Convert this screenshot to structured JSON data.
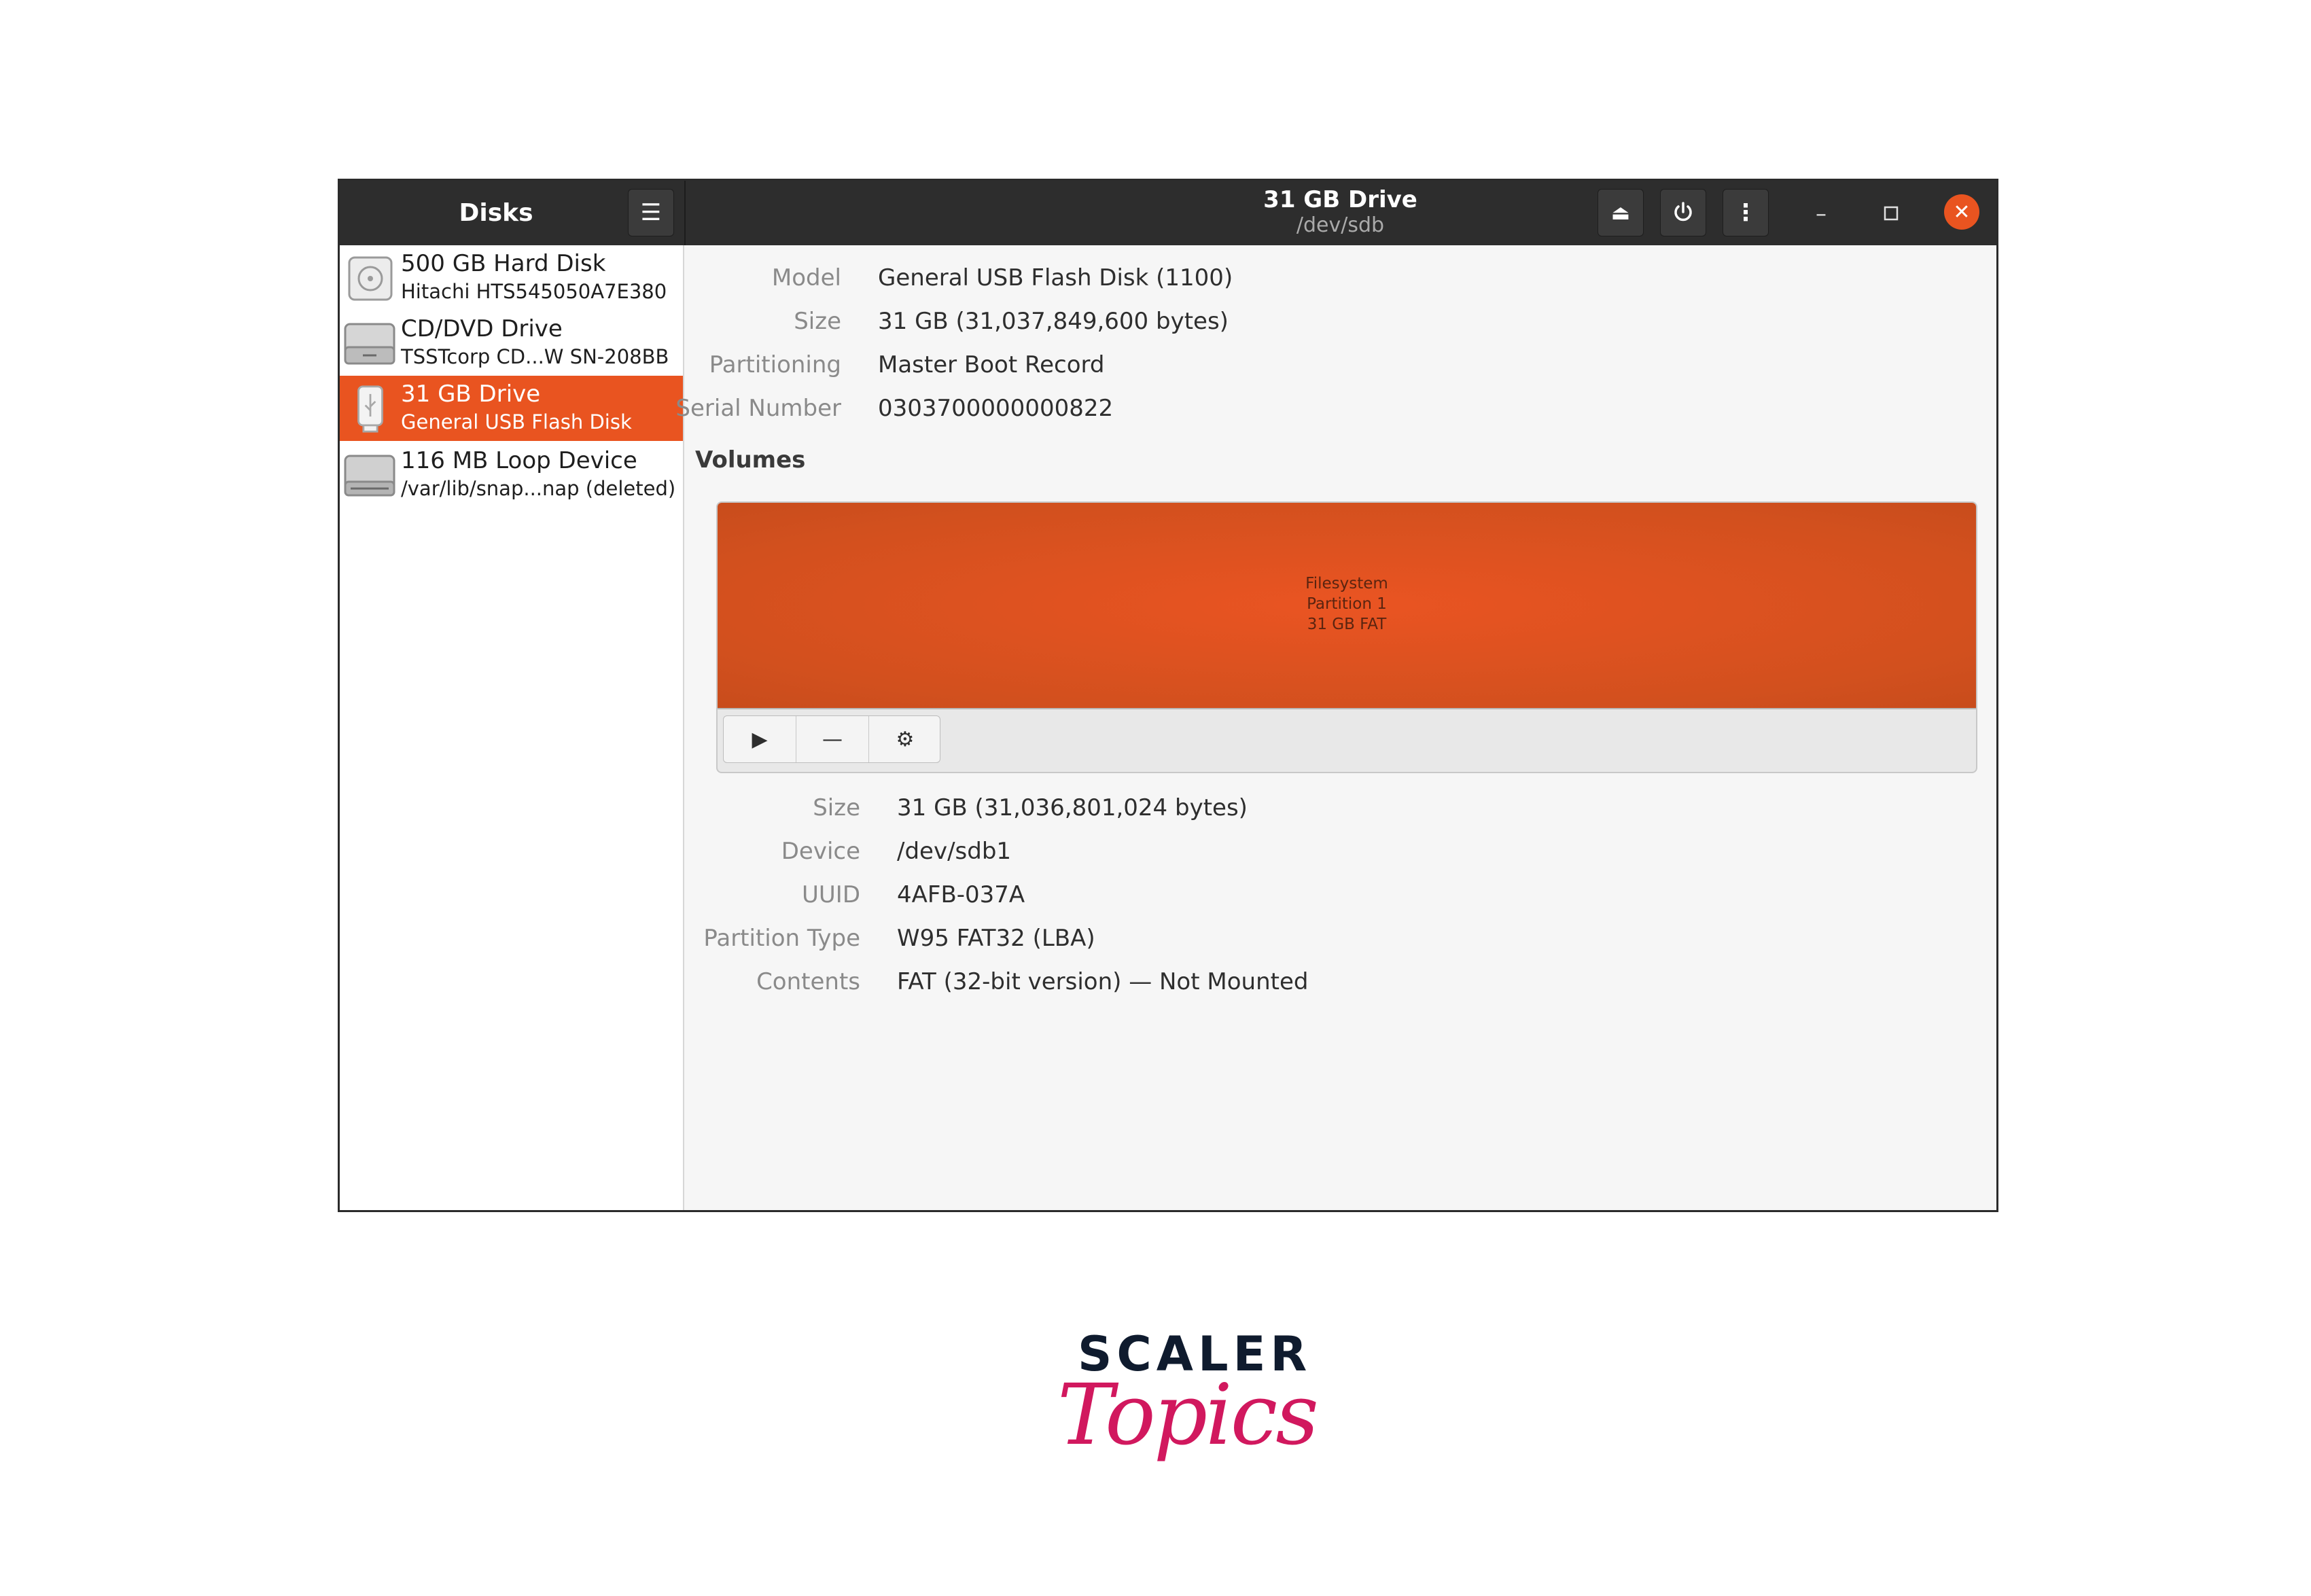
{
  "app": {
    "title": "Disks",
    "window_title": "31 GB Drive",
    "window_subtitle": "/dev/sdb",
    "accent_color": "#e95420"
  },
  "icons": {
    "menu": "hamburger-menu-icon",
    "eject": "eject-icon",
    "power": "power-icon",
    "more": "vertical-ellipsis-icon",
    "minimize": "minimize-icon",
    "maximize": "maximize-icon",
    "close": "close-icon",
    "play": "play-icon",
    "minus": "minus-icon",
    "settings": "gears-icon"
  },
  "headerbar": {
    "menu_glyph": "☰",
    "eject_glyph": "⏏",
    "more_glyph": "⋮",
    "minimize_glyph": "–",
    "close_glyph": "✕"
  },
  "drives": [
    {
      "name": "500 GB Hard Disk",
      "description": "Hitachi HTS545050A7E380",
      "icon": "hard-disk-icon",
      "selected": false
    },
    {
      "name": "CD/DVD Drive",
      "description": "TSSTcorp CD...W SN-208BB",
      "icon": "optical-drive-icon",
      "selected": false
    },
    {
      "name": "31 GB Drive",
      "description": "General USB Flash Disk",
      "icon": "usb-drive-icon",
      "selected": true
    },
    {
      "name": "116 MB Loop Device",
      "description": "/var/lib/snap...nap (deleted)",
      "icon": "loop-device-icon",
      "selected": false
    }
  ],
  "drive_info": [
    {
      "label": "Model",
      "value": "General USB Flash Disk (1100)"
    },
    {
      "label": "Size",
      "value": "31 GB (31,037,849,600 bytes)"
    },
    {
      "label": "Partitioning",
      "value": "Master Boot Record"
    },
    {
      "label": "Serial Number",
      "value": "0303700000000822"
    }
  ],
  "volumes": {
    "heading": "Volumes",
    "partition": {
      "line1": "Filesystem",
      "line2": "Partition 1",
      "line3": "31 GB FAT"
    },
    "toolbar": {
      "play_glyph": "▶",
      "minus_glyph": "—",
      "settings_glyph": "⚙"
    }
  },
  "partition_info": [
    {
      "label": "Size",
      "value": "31 GB (31,036,801,024 bytes)"
    },
    {
      "label": "Device",
      "value": "/dev/sdb1"
    },
    {
      "label": "UUID",
      "value": "4AFB-037A"
    },
    {
      "label": "Partition Type",
      "value": "W95 FAT32 (LBA)"
    },
    {
      "label": "Contents",
      "value": "FAT (32-bit version) — Not Mounted"
    }
  ],
  "logo": {
    "line1": "SCALER",
    "line2": "Topics"
  }
}
